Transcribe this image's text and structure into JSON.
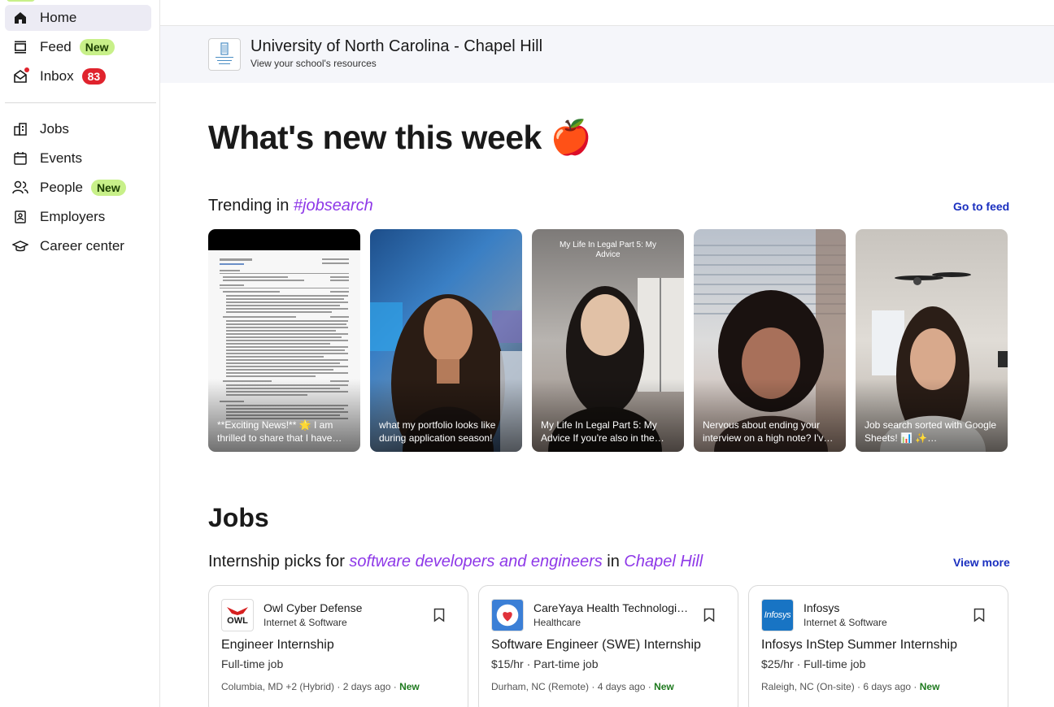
{
  "sidebar": {
    "items": [
      {
        "label": "Home",
        "icon": "home-icon"
      },
      {
        "label": "Feed",
        "icon": "feed-icon",
        "badge": "New"
      },
      {
        "label": "Inbox",
        "icon": "inbox-icon",
        "badge": "83"
      },
      {
        "label": "Jobs",
        "icon": "jobs-icon"
      },
      {
        "label": "Events",
        "icon": "calendar-icon"
      },
      {
        "label": "People",
        "icon": "people-icon",
        "badge": "New"
      },
      {
        "label": "Employers",
        "icon": "employers-icon"
      },
      {
        "label": "Career center",
        "icon": "graduation-cap-icon"
      }
    ]
  },
  "school": {
    "name": "University of North Carolina - Chapel Hill",
    "subtitle": "View your school's resources",
    "logo_text": "THE UNIVERSITY of NORTH CAROLINA at CHAPEL HILL"
  },
  "main": {
    "headline": "What's new this week",
    "headline_emoji": "🍎",
    "trending": {
      "prefix": "Trending in ",
      "tag": "#jobsearch",
      "link": "Go to feed",
      "videos": [
        {
          "caption": "**Exciting News!** 🌟 I am thrilled to share that I have…"
        },
        {
          "caption": "what my portfolio looks like during application season!"
        },
        {
          "caption": "My Life In Legal Part 5: My Advice If you're also in the…",
          "overlay": "My Life In Legal Part 5: My Advice"
        },
        {
          "caption": "Nervous about ending your interview on a high note? I'v…"
        },
        {
          "caption": "Job search sorted with Google Sheets! 📊 ✨…"
        }
      ]
    },
    "jobs": {
      "heading": "Jobs",
      "picks_prefix": "Internship picks for ",
      "picks_role": "software developers and engineers",
      "picks_in": " in ",
      "picks_location": "Chapel Hill",
      "link": "View more",
      "cards": [
        {
          "company": "Owl Cyber Defense",
          "industry": "Internet & Software",
          "title": "Engineer Internship",
          "type": "Full-time job",
          "meta": "Columbia, MD +2 (Hybrid) · 2 days ago · ",
          "new": "New",
          "logo_text": "OWL"
        },
        {
          "company": "CareYaya Health Technologi…",
          "industry": "Healthcare",
          "title": "Software Engineer (SWE) Internship",
          "type": "$15/hr · Part-time job",
          "meta": "Durham, NC (Remote) · 4 days ago · ",
          "new": "New",
          "logo_text": ""
        },
        {
          "company": "Infosys",
          "industry": "Internet & Software",
          "title": "Infosys InStep Summer Internship",
          "type": "$25/hr · Full-time job",
          "meta": "Raleigh, NC (On-site) · 6 days ago · ",
          "new": "New",
          "logo_text": "Infosys"
        }
      ]
    }
  },
  "colors": {
    "accent_purple": "#8e38e8",
    "link_blue": "#1a2fbf",
    "badge_green": "#c8f089",
    "badge_red": "#e0232d",
    "new_green": "#1f7a1f"
  }
}
